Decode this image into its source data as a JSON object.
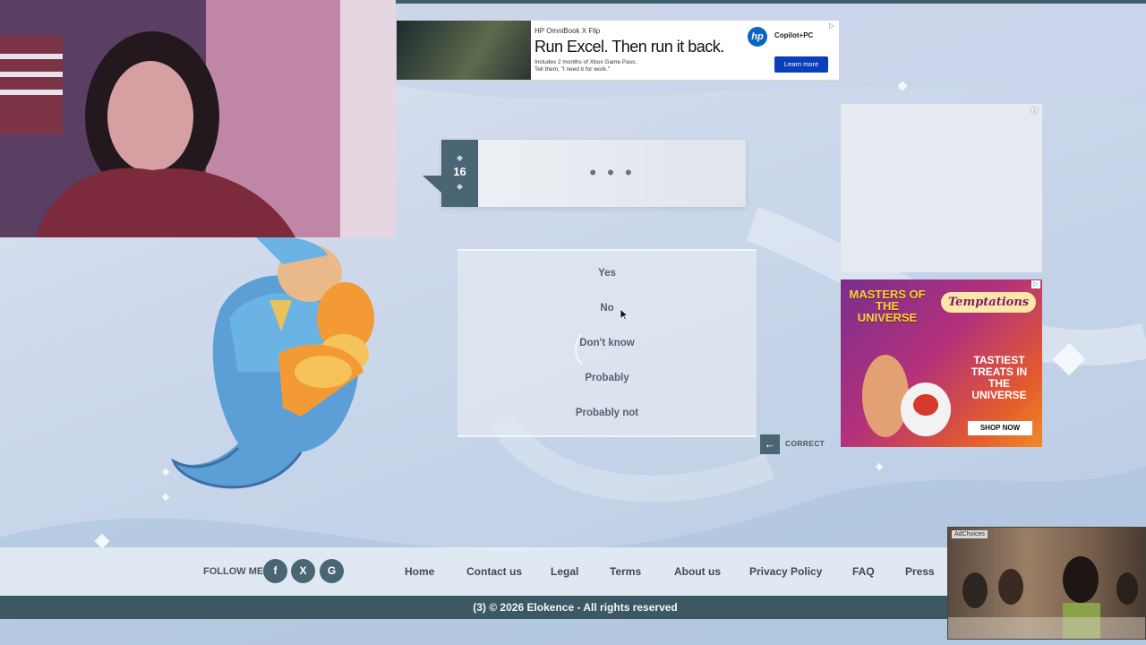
{
  "question": {
    "number": "16",
    "text": "• • •"
  },
  "answers": [
    {
      "label": "Yes"
    },
    {
      "label": "No"
    },
    {
      "label": "Don't know"
    },
    {
      "label": "Probably"
    },
    {
      "label": "Probably not"
    }
  ],
  "correct": {
    "label": "CORRECT",
    "icon": "arrow-left-icon"
  },
  "ads": {
    "top": {
      "brand_line": "HP OmniBook X Flip",
      "headline": "Run Excel. Then run it back.",
      "sub_line1": "Includes 2 months of Xbox Game Pass.",
      "sub_line2": "Tell them, \"I need it for work.\"",
      "logo_text": "hp",
      "copilot": "Copilot+PC",
      "cta": "Learn more"
    },
    "side": {
      "title": "MASTERS OF THE UNIVERSE",
      "brand": "Temptations",
      "tagline": "TASTIEST TREATS IN THE UNIVERSE",
      "cta": "SHOP NOW"
    },
    "video": {
      "adchoices": "AdChoices"
    }
  },
  "footer": {
    "follow_label": "FOLLOW ME",
    "social": [
      {
        "icon": "facebook-icon",
        "glyph": "f"
      },
      {
        "icon": "x-icon",
        "glyph": "X"
      },
      {
        "icon": "google-icon",
        "glyph": "G"
      }
    ],
    "nav": [
      "Home",
      "Contact us",
      "Legal",
      "Terms",
      "About us",
      "Privacy Policy",
      "FAQ",
      "Press"
    ],
    "copyright": "(3)  © 2026 Elokence - All rights reserved"
  },
  "colors": {
    "accent": "#4a6573",
    "footer_dark": "#3d5865"
  }
}
